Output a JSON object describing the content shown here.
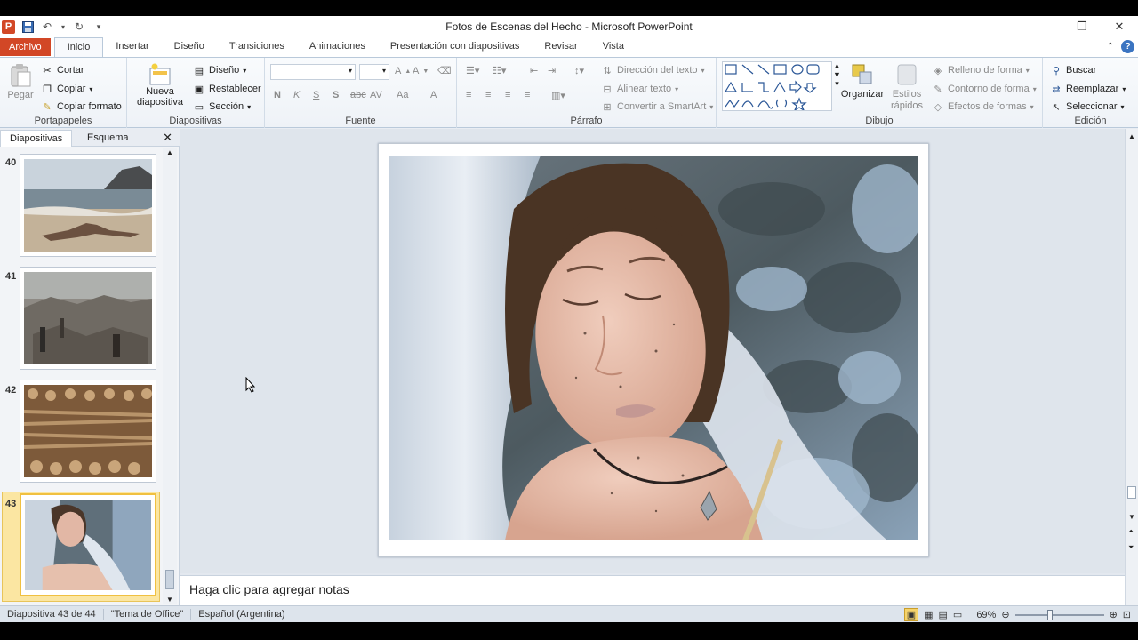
{
  "app": {
    "title": "Fotos de Escenas del Hecho  -  Microsoft PowerPoint",
    "logo_letter": "P"
  },
  "tabs": [
    {
      "label": "Archivo"
    },
    {
      "label": "Inicio"
    },
    {
      "label": "Insertar"
    },
    {
      "label": "Diseño"
    },
    {
      "label": "Transiciones"
    },
    {
      "label": "Animaciones"
    },
    {
      "label": "Presentación con diapositivas"
    },
    {
      "label": "Revisar"
    },
    {
      "label": "Vista"
    }
  ],
  "ribbon": {
    "clipboard": {
      "label": "Portapapeles",
      "paste": "Pegar",
      "cut": "Cortar",
      "copy": "Copiar",
      "format_painter": "Copiar formato"
    },
    "slides": {
      "label": "Diapositivas",
      "new_slide_1": "Nueva",
      "new_slide_2": "diapositiva",
      "layout": "Diseño",
      "reset": "Restablecer",
      "section": "Sección"
    },
    "font": {
      "label": "Fuente",
      "bold": "N",
      "italic": "K",
      "underline": "S",
      "shadow": "S",
      "strike": "abc",
      "spacing": "AV",
      "case": "Aa",
      "color": "A"
    },
    "paragraph": {
      "label": "Párrafo",
      "text_direction": "Dirección del texto",
      "align_text": "Alinear texto",
      "smartart": "Convertir a SmartArt"
    },
    "drawing": {
      "label": "Dibujo",
      "arrange": "Organizar",
      "styles_1": "Estilos",
      "styles_2": "rápidos",
      "fill": "Relleno de forma",
      "outline": "Contorno de forma",
      "effects": "Efectos de formas"
    },
    "editing": {
      "label": "Edición",
      "find": "Buscar",
      "replace": "Reemplazar",
      "select": "Seleccionar"
    }
  },
  "panel": {
    "tab_slides": "Diapositivas",
    "tab_outline": "Esquema",
    "close": "✕",
    "thumbnails": [
      {
        "number": "40"
      },
      {
        "number": "41"
      },
      {
        "number": "42"
      },
      {
        "number": "43"
      }
    ]
  },
  "notes": {
    "placeholder": "Haga clic para agregar notas"
  },
  "status": {
    "slide": "Diapositiva 43 de 44",
    "theme": "\"Tema de Office\"",
    "language": "Español (Argentina)",
    "zoom": "69%"
  },
  "colors": {
    "file_tab": "#d24726",
    "accent": "#2b5797",
    "selected_thumb": "#f0c040"
  }
}
